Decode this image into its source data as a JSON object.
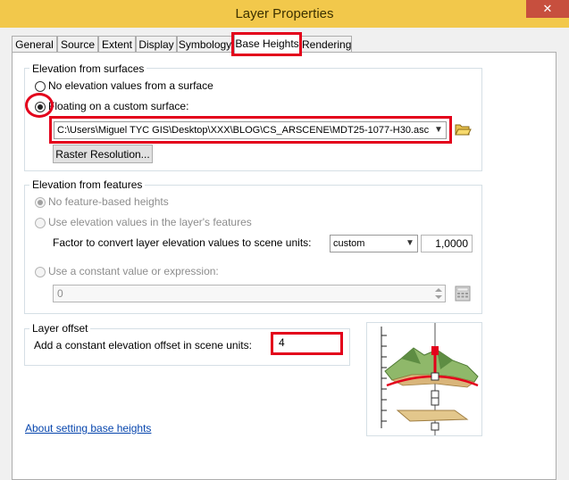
{
  "window": {
    "title": "Layer Properties",
    "close_glyph": "✕"
  },
  "tabs": [
    {
      "label": "General"
    },
    {
      "label": "Source"
    },
    {
      "label": "Extent"
    },
    {
      "label": "Display"
    },
    {
      "label": "Symbology"
    },
    {
      "label": "Base Heights"
    },
    {
      "label": "Rendering"
    }
  ],
  "surfaces": {
    "group_label": "Elevation from surfaces",
    "no_elevation_label": "No elevation values from a surface",
    "floating_label": "Floating on a custom surface:",
    "surface_path": "C:\\Users\\Miguel TYC GIS\\Desktop\\XXX\\BLOG\\CS_ARSCENE\\MDT25-1077-H30.asc",
    "raster_resolution_label": "Raster Resolution..."
  },
  "features": {
    "group_label": "Elevation from features",
    "no_feature_label": "No feature-based heights",
    "use_values_label": "Use elevation values in the layer's features",
    "factor_label": "Factor to convert layer elevation values to scene units:",
    "unit_selected": "custom",
    "factor_value": "1,0000",
    "constant_label": "Use a constant value or expression:",
    "constant_value": "0"
  },
  "offset": {
    "group_label": "Layer offset",
    "offset_label": "Add a constant elevation offset in scene units:",
    "offset_value": "4"
  },
  "help_link": "About setting base heights",
  "colors": {
    "highlight": "#e3001b",
    "titlebar": "#f2c84b",
    "terrain": "#7fa860"
  }
}
